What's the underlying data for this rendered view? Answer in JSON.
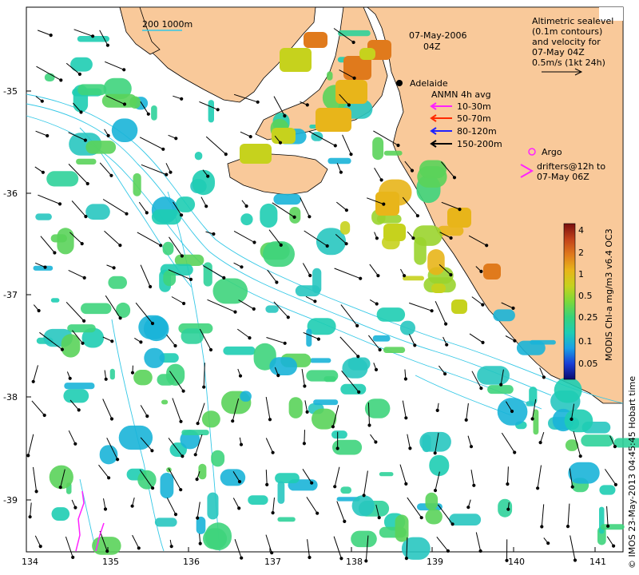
{
  "map": {
    "date_line1": "07-May-2006",
    "date_line2": "04Z",
    "scale_label": "200  1000m",
    "place": "Adelaide",
    "x_ticks": [
      "134",
      "135",
      "136",
      "137",
      "138",
      "139",
      "140",
      "141"
    ],
    "y_ticks": [
      "-35",
      "-36",
      "-37",
      "-38",
      "-39"
    ],
    "credit": "© IMOS 23-May-2013 04:45:45 Hobart time",
    "colors": {
      "land": "#f9c99a",
      "ocean": "#ffffff",
      "contour": "#35c8e6",
      "arrow": "#000000",
      "argo": "#ff22ff"
    }
  },
  "legend": {
    "sealevel_lines": [
      "Altimetric sealevel",
      "(0.1m contours)",
      "and velocity for",
      "07-May 04Z",
      "0.5m/s (1kt 24h)"
    ],
    "anmn_title": "ANMN 4h avg",
    "anmn_items": [
      {
        "label": "10-30m",
        "color": "#ff22ff"
      },
      {
        "label": "50-70m",
        "color": "#ff2a00"
      },
      {
        "label": "80-120m",
        "color": "#1f23ff"
      },
      {
        "label": "150-200m",
        "color": "#000000"
      }
    ],
    "argo_label": "Argo",
    "drifters_line1": "drifters@12h to",
    "drifters_line2": "07-May 06Z"
  },
  "colorbar": {
    "title": "MODIS Chl-a mg/m3 v6.4 OC3",
    "ticks": [
      "4",
      "2",
      "1",
      "0.5",
      "0.25",
      "0.1",
      "0.05"
    ],
    "colors": [
      "#0a0a6e",
      "#1a3dd6",
      "#1aa0e6",
      "#1ecdb3",
      "#37d27a",
      "#7cd83a",
      "#c6d21d",
      "#e8b51a",
      "#e07a1c",
      "#c2421a",
      "#7a0f0f"
    ]
  }
}
